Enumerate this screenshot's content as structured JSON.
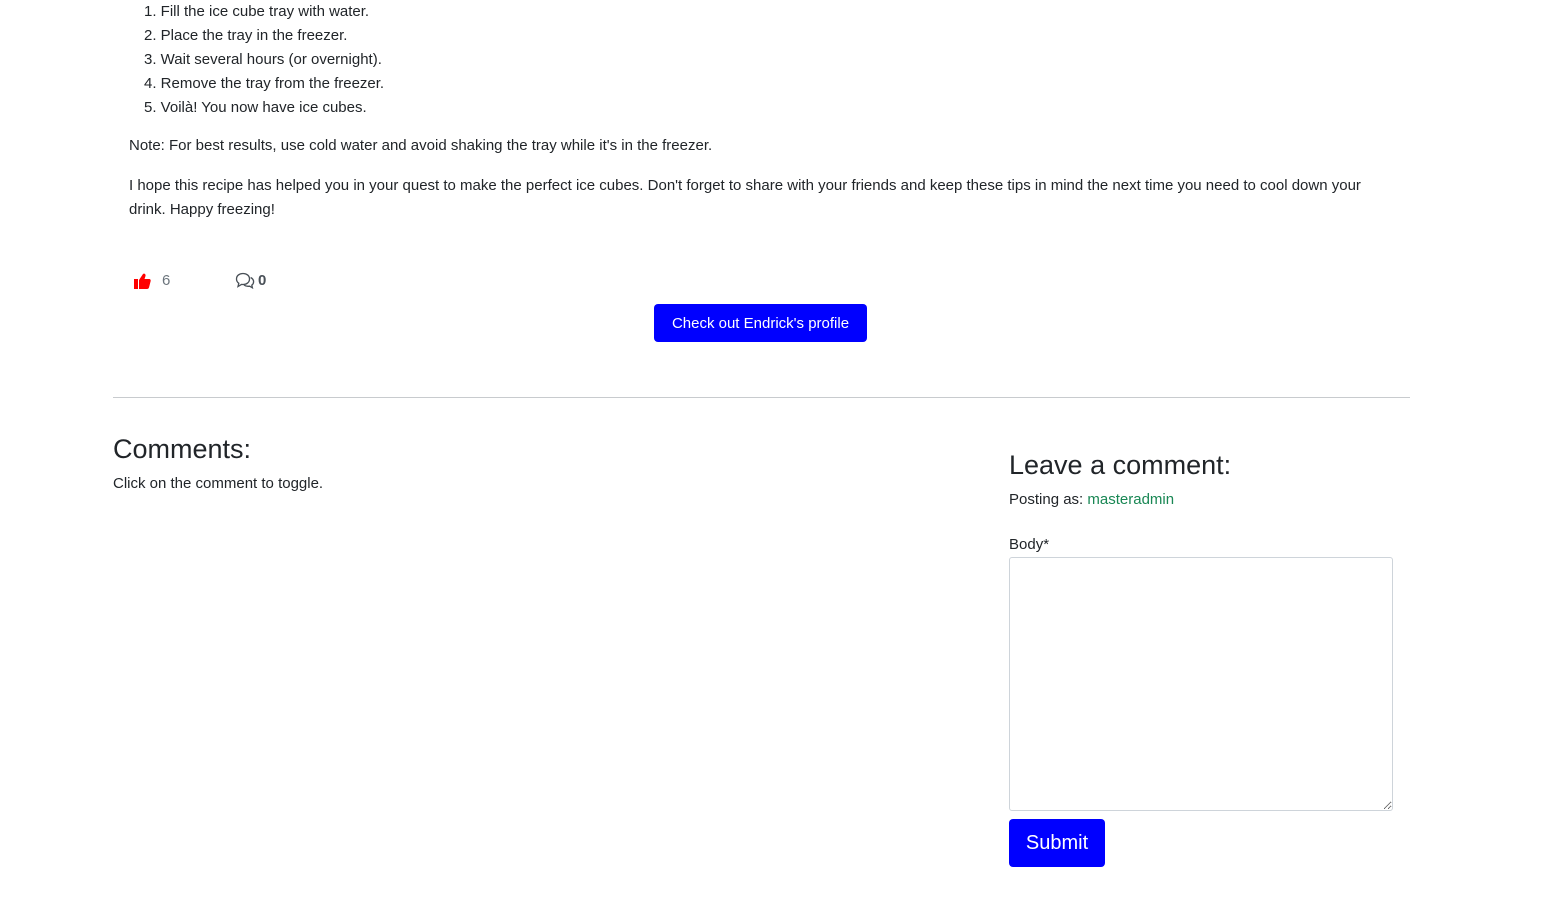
{
  "post": {
    "steps": [
      "1. Fill the ice cube tray with water.",
      "2. Place the tray in the freezer.",
      "3. Wait several hours (or overnight).",
      "4. Remove the tray from the freezer.",
      "5. Voilà! You now have ice cubes."
    ],
    "note": "Note: For best results, use cold water and avoid shaking the tray while it's in the freezer.",
    "closing": "I hope this recipe has helped you in your quest to make the perfect ice cubes. Don't forget to share with your friends and keep these tips in mind the next time you need to cool down your drink. Happy freezing!"
  },
  "stats": {
    "likes": "6",
    "like_icon": "thumbs-up-icon",
    "like_color": "#ff0000",
    "comments": "0",
    "comment_icon": "chat-bubbles-icon"
  },
  "profile_button": {
    "label": "Check out Endrick's profile",
    "color": "#0000ff"
  },
  "comments_section": {
    "heading": "Comments:",
    "hint": "Click on the comment to toggle."
  },
  "comment_form": {
    "heading": "Leave a comment:",
    "posting_as_label": "Posting as:",
    "username": "masteradmin",
    "body_label": "Body*",
    "body_value": "",
    "submit_label": "Submit",
    "username_color": "#198754"
  }
}
